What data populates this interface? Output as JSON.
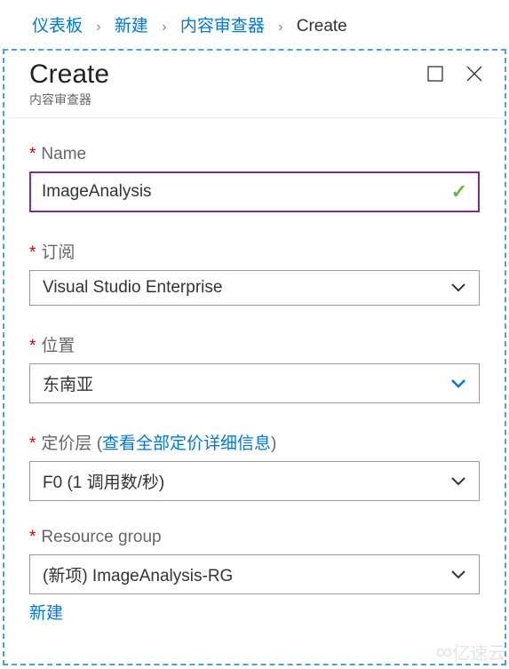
{
  "breadcrumb": {
    "items": [
      "仪表板",
      "新建",
      "内容审查器",
      "Create"
    ]
  },
  "header": {
    "title": "Create",
    "subtitle": "内容审查器"
  },
  "form": {
    "name": {
      "label": "Name",
      "value": "ImageAnalysis"
    },
    "subscription": {
      "label": "订阅",
      "value": "Visual Studio Enterprise"
    },
    "location": {
      "label": "位置",
      "value": "东南亚"
    },
    "pricing": {
      "label": "定价层",
      "link_text": "查看全部定价详细信息",
      "value": "F0 (1 调用数/秒)"
    },
    "resource_group": {
      "label": "Resource group",
      "value": "(新项) ImageAnalysis-RG",
      "new_link": "新建"
    }
  },
  "watermark": {
    "text": "亿速云"
  }
}
